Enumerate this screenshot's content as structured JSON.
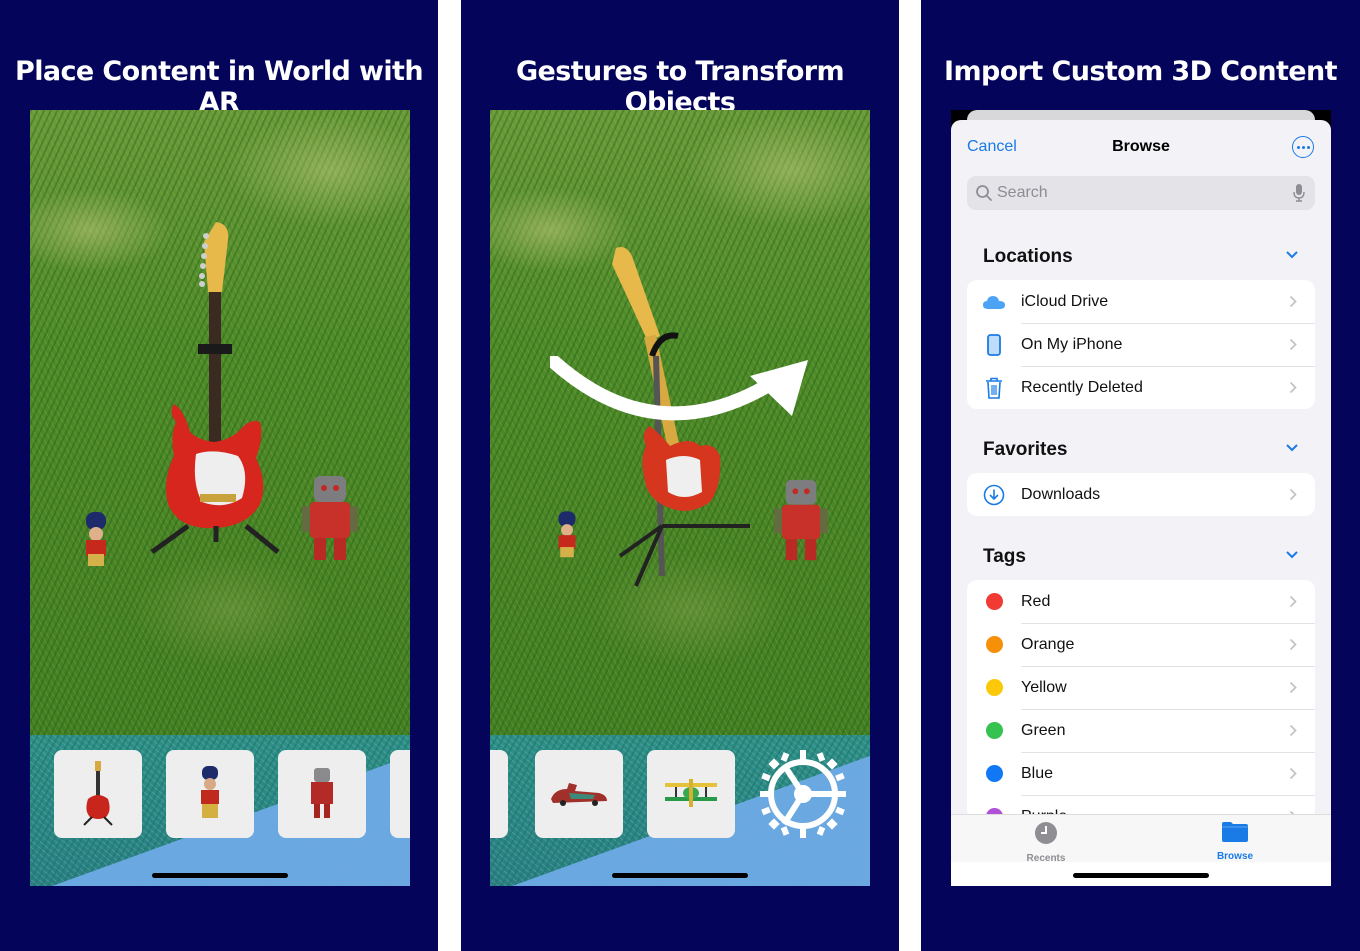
{
  "panels": [
    {
      "title": "Place Content in World with AR",
      "tray": [
        "guitar",
        "toy-soldier",
        "robot"
      ]
    },
    {
      "title": "Gestures to Transform Objects",
      "tray": [
        "race-car",
        "biplane",
        "settings"
      ]
    },
    {
      "title": "Import Custom 3D Content"
    }
  ],
  "browser": {
    "cancel_label": "Cancel",
    "title": "Browse",
    "search_placeholder": "Search",
    "sections": {
      "locations": {
        "label": "Locations",
        "items": [
          {
            "label": "iCloud Drive",
            "icon": "icloud-icon"
          },
          {
            "label": "On My iPhone",
            "icon": "iphone-icon"
          },
          {
            "label": "Recently Deleted",
            "icon": "trash-icon"
          }
        ]
      },
      "favorites": {
        "label": "Favorites",
        "items": [
          {
            "label": "Downloads",
            "icon": "download-icon"
          }
        ]
      },
      "tags": {
        "label": "Tags",
        "items": [
          {
            "label": "Red",
            "color": "#f03a33"
          },
          {
            "label": "Orange",
            "color": "#f79009"
          },
          {
            "label": "Yellow",
            "color": "#fcc80a"
          },
          {
            "label": "Green",
            "color": "#35c24e"
          },
          {
            "label": "Blue",
            "color": "#1078f5"
          },
          {
            "label": "Purple",
            "color": "#b150d8"
          }
        ]
      }
    },
    "tabbar": {
      "recents_label": "Recents",
      "browse_label": "Browse",
      "active": "Browse"
    }
  },
  "colors": {
    "background": "#03045a",
    "accent": "#1a7ae6"
  }
}
